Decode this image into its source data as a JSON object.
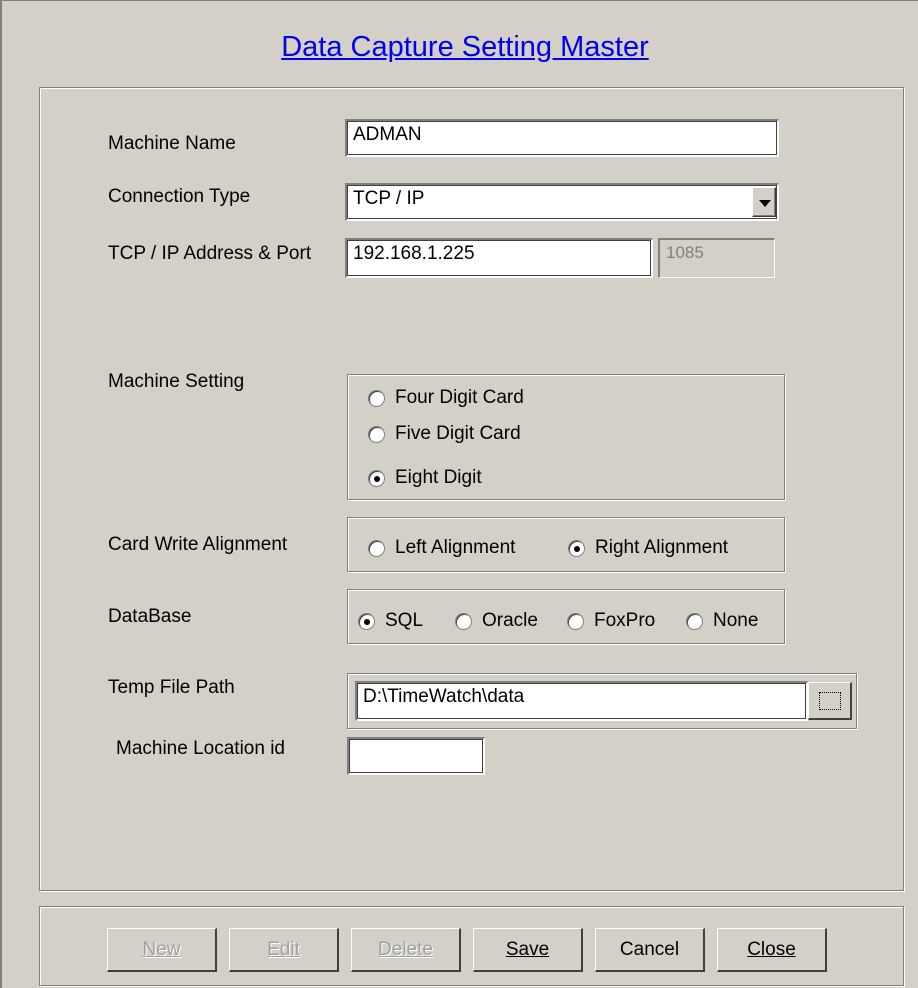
{
  "title": "Data Capture Setting Master",
  "form": {
    "machine_name_label": "Machine Name",
    "machine_name_value": "ADMAN",
    "connection_type_label": "Connection Type",
    "connection_type_value": "TCP / IP",
    "tcp_label": "TCP / IP Address & Port",
    "ip_value": "192.168.1.225",
    "port_value": "1085",
    "machine_setting_label": "Machine Setting",
    "machine_setting_options": [
      "Four Digit Card",
      "Five Digit Card",
      "Eight Digit"
    ],
    "machine_setting_selected": "Eight Digit",
    "card_write_label": "Card Write Alignment",
    "card_write_options": [
      "Left Alignment",
      "Right Alignment"
    ],
    "card_write_selected": "Right Alignment",
    "database_label": "DataBase",
    "database_options": [
      "SQL",
      "Oracle",
      "FoxPro",
      "None"
    ],
    "database_selected": "SQL",
    "temp_path_label": "Temp File Path",
    "temp_path_value": "D:\\TimeWatch\\data",
    "location_label": "Machine Location id",
    "location_value": ""
  },
  "buttons": {
    "new": {
      "label": "New",
      "enabled": false
    },
    "edit": {
      "label": "Edit",
      "enabled": false
    },
    "delete": {
      "label": "Delete",
      "enabled": false
    },
    "save": {
      "label": "Save",
      "enabled": true
    },
    "cancel": {
      "label": "Cancel",
      "enabled": true
    },
    "close": {
      "label": "Close",
      "enabled": true
    }
  },
  "icons": {
    "dropdown": "chevron-down-icon",
    "browse": "browse-folder-icon"
  }
}
